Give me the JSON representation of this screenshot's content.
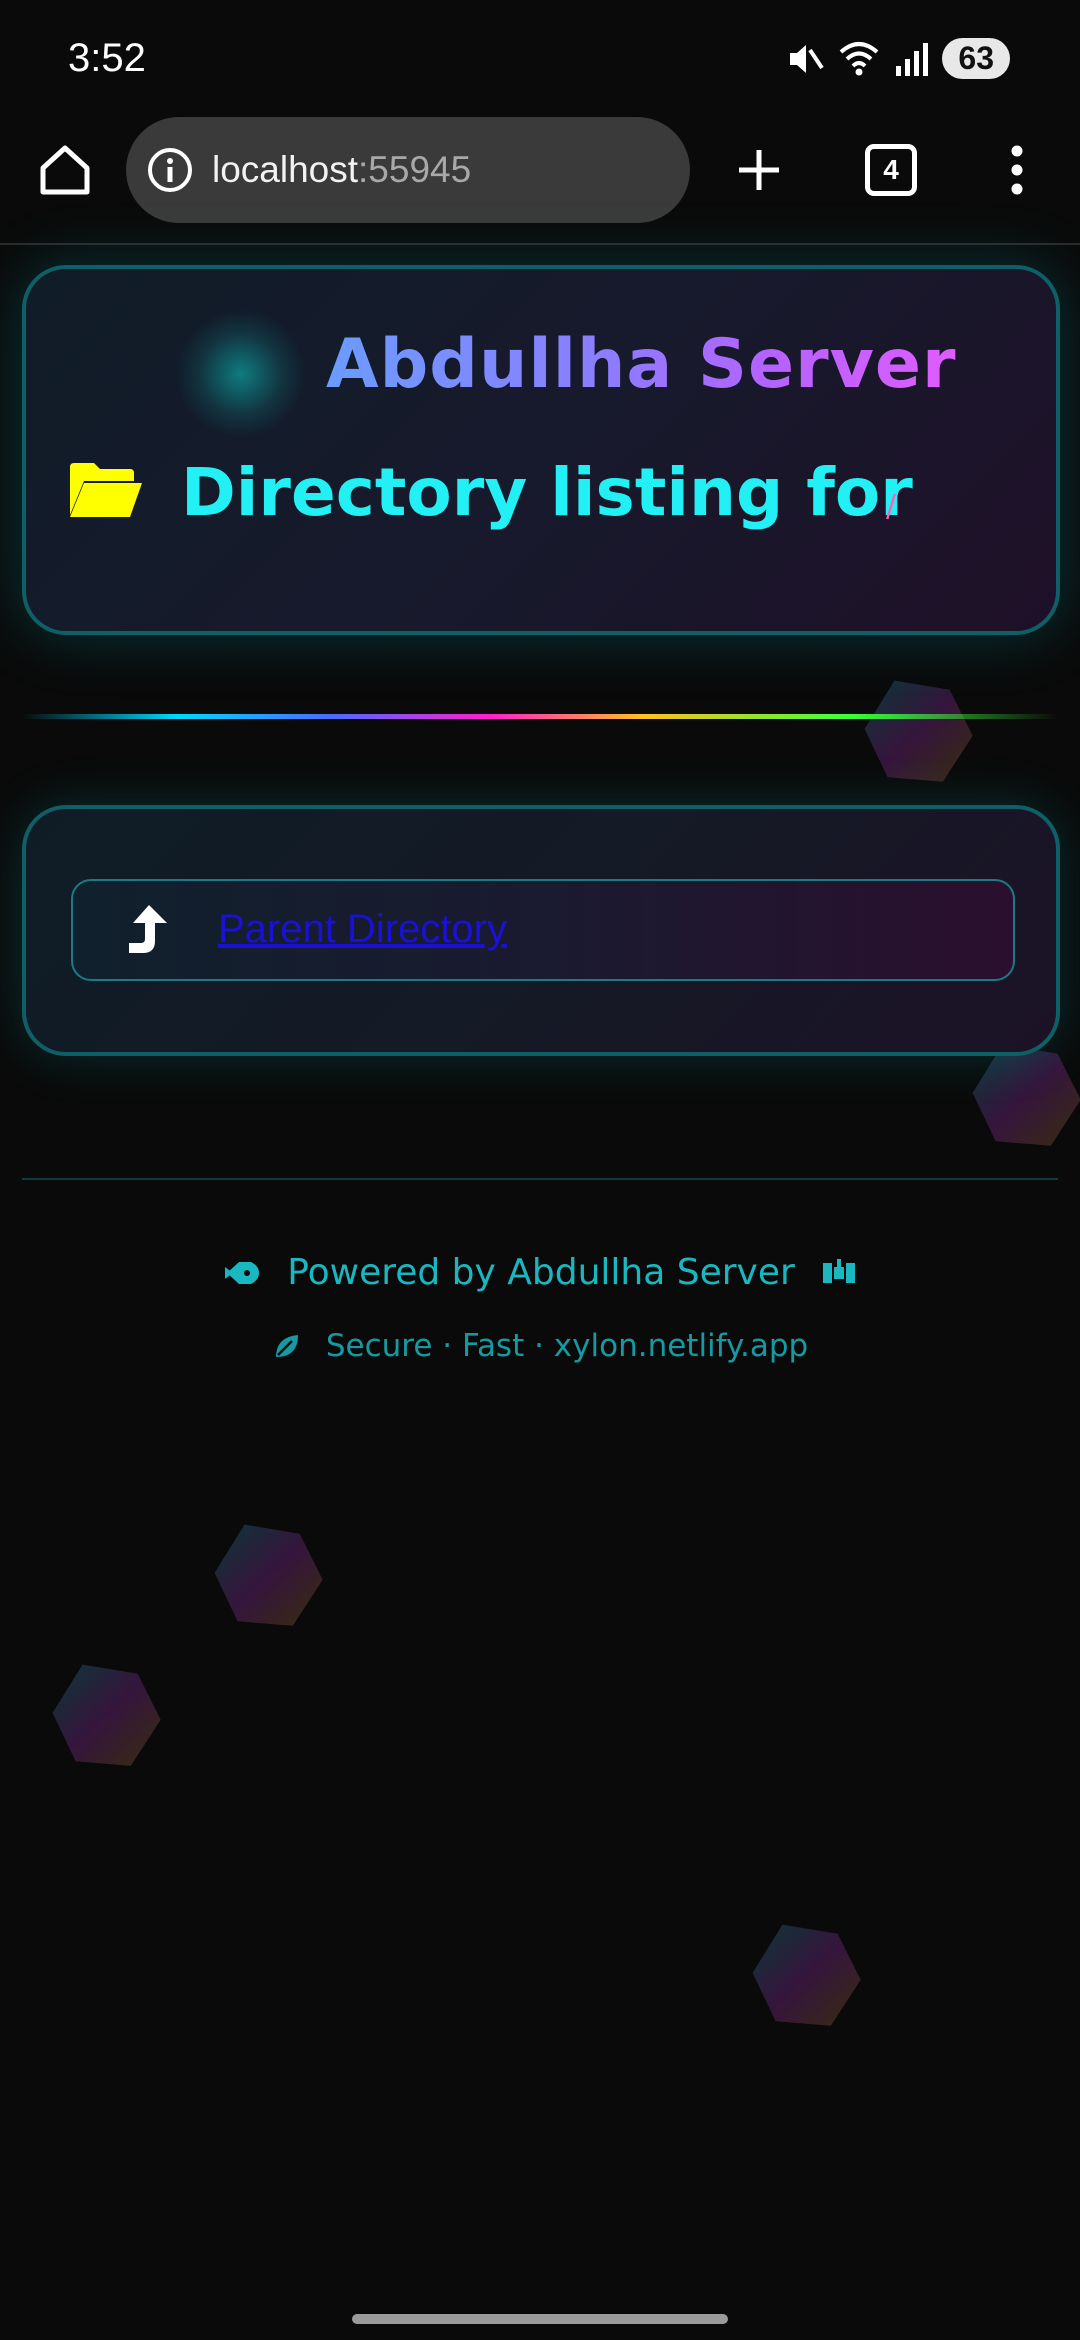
{
  "status_bar": {
    "time": "3:52",
    "battery": "63"
  },
  "browser": {
    "url_host": "localhost",
    "url_port": ":55945",
    "tab_count": "4"
  },
  "header": {
    "title": "Abdullha Server",
    "heading": "Directory listing for",
    "path": "/"
  },
  "listing": {
    "parent_label": "Parent Directory"
  },
  "footer": {
    "powered": "Powered by Abdullha Server",
    "tagline": "Secure · Fast · xylon.netlify.app"
  },
  "colors": {
    "accent_cyan": "#22f0f5",
    "folder": "#ffff00",
    "link": "#1a10d6",
    "footer": "#19b8c0"
  }
}
